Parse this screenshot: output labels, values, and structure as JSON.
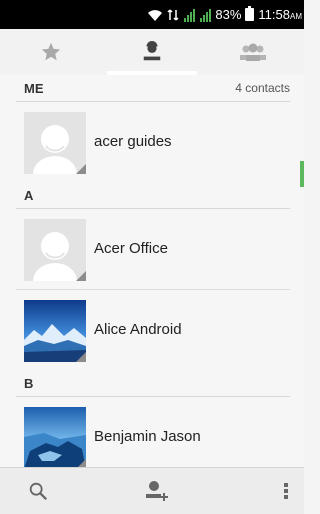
{
  "status_bar": {
    "battery_percent": "83%",
    "time": "11:58",
    "time_suffix": "AM"
  },
  "tabs": [
    {
      "icon": "star-icon",
      "name": "favorites",
      "active": false
    },
    {
      "icon": "person-icon",
      "name": "contacts",
      "active": true
    },
    {
      "icon": "group-icon",
      "name": "groups",
      "active": false
    }
  ],
  "sections": {
    "me": {
      "label": "ME",
      "count": "4 contacts"
    },
    "a": {
      "label": "A"
    },
    "b": {
      "label": "B"
    }
  },
  "contacts": [
    {
      "name": "acer guides",
      "avatar": "placeholder"
    },
    {
      "name": "Acer Office",
      "avatar": "placeholder"
    },
    {
      "name": "Alice Android",
      "avatar": "photo"
    },
    {
      "name": "Benjamin Jason",
      "avatar": "photo"
    }
  ],
  "bottom_bar": {
    "actions": [
      "search-icon",
      "add-contact-icon",
      "overflow-menu-icon"
    ]
  },
  "colors": {
    "accent_scroll": "#5cb85c",
    "signal_green": "#4caf50"
  }
}
